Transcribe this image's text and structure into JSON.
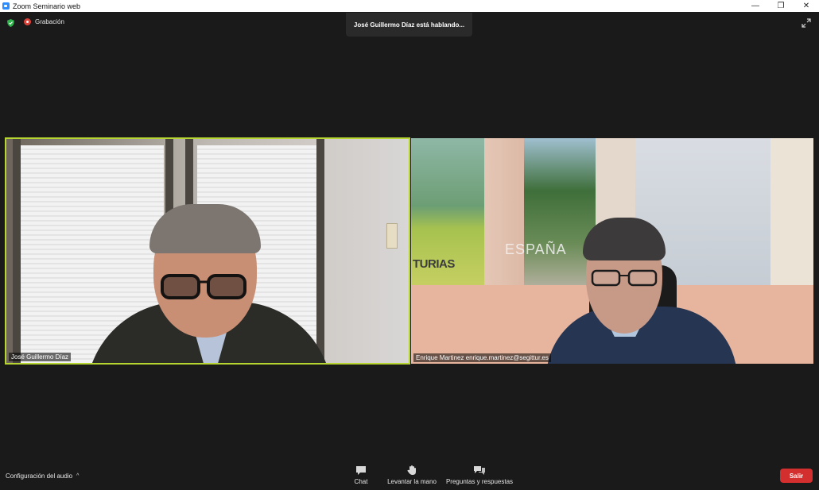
{
  "window": {
    "title": "Zoom Seminario web",
    "controls": {
      "minimize": "—",
      "restore": "❐",
      "close": "✕"
    }
  },
  "meeting": {
    "recording_label": "Grabación",
    "speaking_banner": "José Guillermo Díaz está hablando...",
    "security_icon": "shield-check-icon",
    "expand_icon": "expand-icon"
  },
  "participants": [
    {
      "name": "José Guillermo Díaz",
      "active_speaker": true,
      "highlight_color": "#b6d531"
    },
    {
      "name": "Enrique Martinez enrique.martinez@segittur.es",
      "active_speaker": false
    }
  ],
  "backdrop_text": {
    "poster_left": "TURIAS",
    "poster_center": "ESPAÑA"
  },
  "toolbar": {
    "audio_settings_label": "Configuración del audio",
    "chat_label": "Chat",
    "raise_hand_label": "Levantar la mano",
    "qa_label": "Preguntas y respuestas",
    "leave_label": "Salir",
    "leave_color": "#d32f2f"
  }
}
